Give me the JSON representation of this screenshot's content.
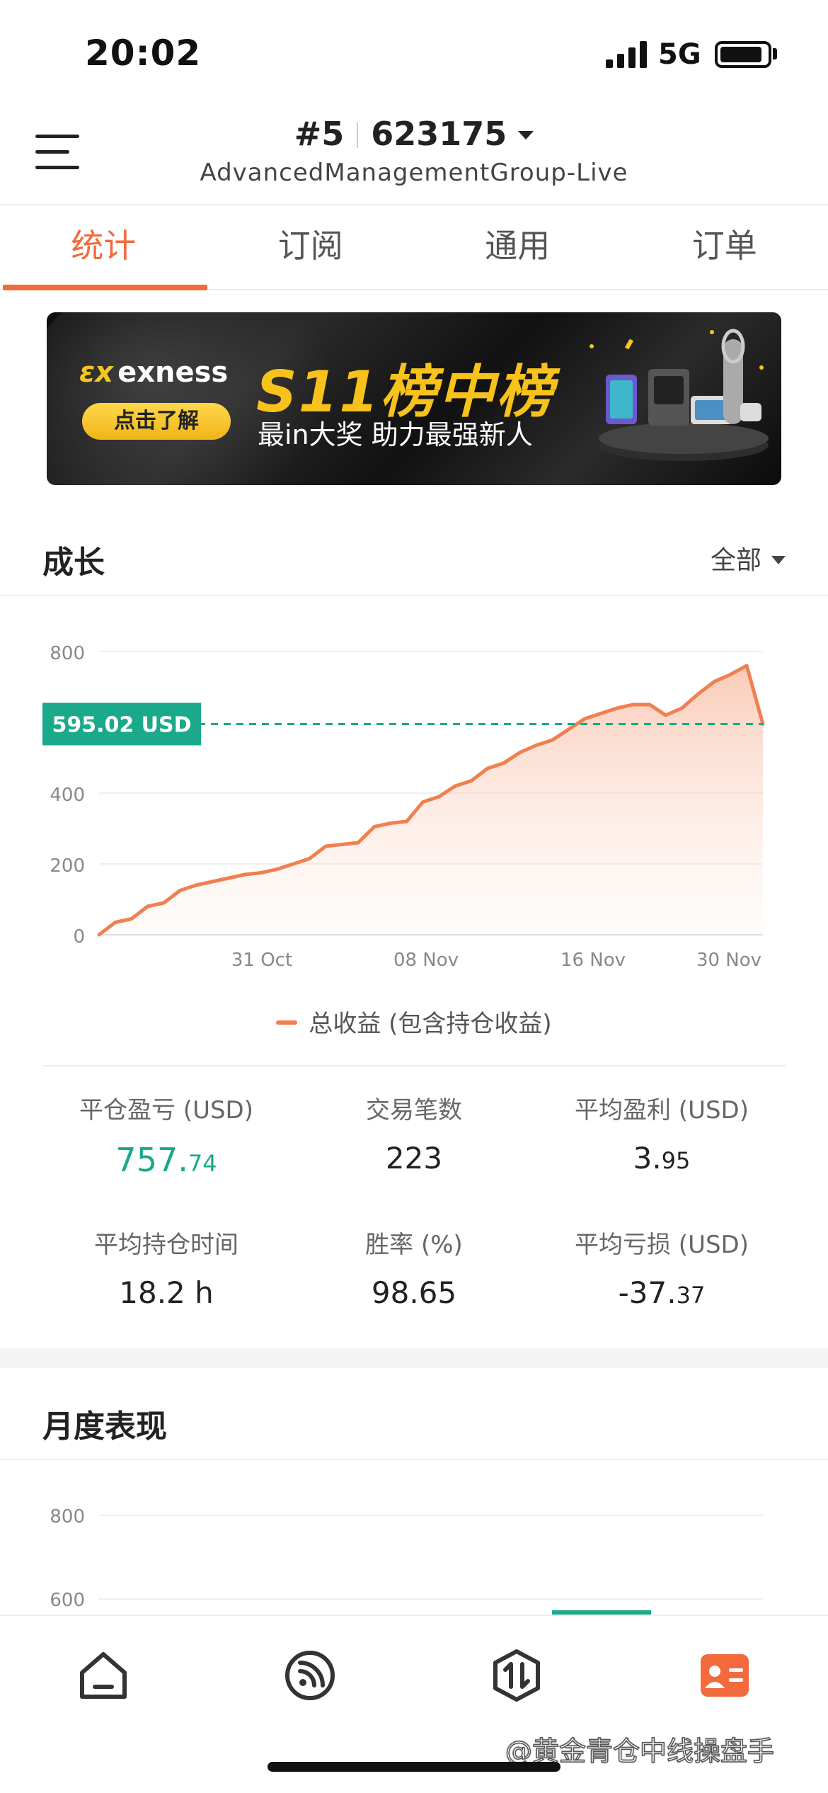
{
  "status_bar": {
    "time": "20:02",
    "network": "5G"
  },
  "header": {
    "account_number": "#5",
    "account_id": "623175",
    "server": "AdvancedManagementGroup-Live"
  },
  "tabs": [
    {
      "label": "统计",
      "active": true
    },
    {
      "label": "订阅",
      "active": false
    },
    {
      "label": "通用",
      "active": false
    },
    {
      "label": "订单",
      "active": false
    }
  ],
  "banner": {
    "brand": "exness",
    "button": "点击了解",
    "title": "S11榜中榜",
    "subtitle": "最in大奖 助力最强新人"
  },
  "growth": {
    "title": "成长",
    "filter": "全部",
    "current_label": "595.02 USD",
    "legend": "总收益 (包含持仓收益)"
  },
  "stats": [
    {
      "label": "平仓盈亏 (USD)",
      "value_main": "757.",
      "value_small": "74",
      "color": "#1aa98a"
    },
    {
      "label": "交易笔数",
      "value_main": "223",
      "value_small": ""
    },
    {
      "label": "平均盈利 (USD)",
      "value_main": "3.",
      "value_small": "95"
    },
    {
      "label": "平均持仓时间",
      "value_main": "18.2 h",
      "value_small": ""
    },
    {
      "label": "胜率 (%)",
      "value_main": "98.65",
      "value_small": ""
    },
    {
      "label": "平均亏损 (USD)",
      "value_main": "-37.",
      "value_small": "37"
    }
  ],
  "monthly": {
    "title": "月度表现"
  },
  "watermark": "@黄金青仓中线操盘手",
  "colors": {
    "accent": "#f36a3c",
    "line": "#f08050",
    "profit": "#1aa98a"
  },
  "icons": [
    "home-icon",
    "feed-icon",
    "trade-icon",
    "profile-card-icon"
  ],
  "chart_data": [
    {
      "type": "area",
      "title": "",
      "xlabel": "",
      "ylabel": "",
      "ylim": [
        0,
        800
      ],
      "y_ticks": [
        0,
        200,
        400,
        800
      ],
      "x_ticks": [
        "31 Oct",
        "08 Nov",
        "16 Nov",
        "30 Nov"
      ],
      "reference_line": {
        "value": 595.02,
        "label": "595.02 USD",
        "color": "#1aa98a",
        "style": "dashed"
      },
      "series": [
        {
          "values": [
            0,
            35,
            45,
            80,
            90,
            125,
            140,
            150,
            160,
            170,
            175,
            185,
            200,
            215,
            250,
            255,
            260,
            305,
            315,
            320,
            375,
            390,
            420,
            435,
            470,
            485,
            515,
            535,
            550,
            580,
            610,
            625,
            640,
            650,
            650,
            620,
            640,
            680,
            715,
            735,
            760,
            595
          ]
        }
      ],
      "grid": true
    },
    {
      "type": "bar",
      "title": "",
      "ylim": [
        0,
        800
      ],
      "y_ticks": [
        600,
        800
      ],
      "grid": true
    }
  ]
}
